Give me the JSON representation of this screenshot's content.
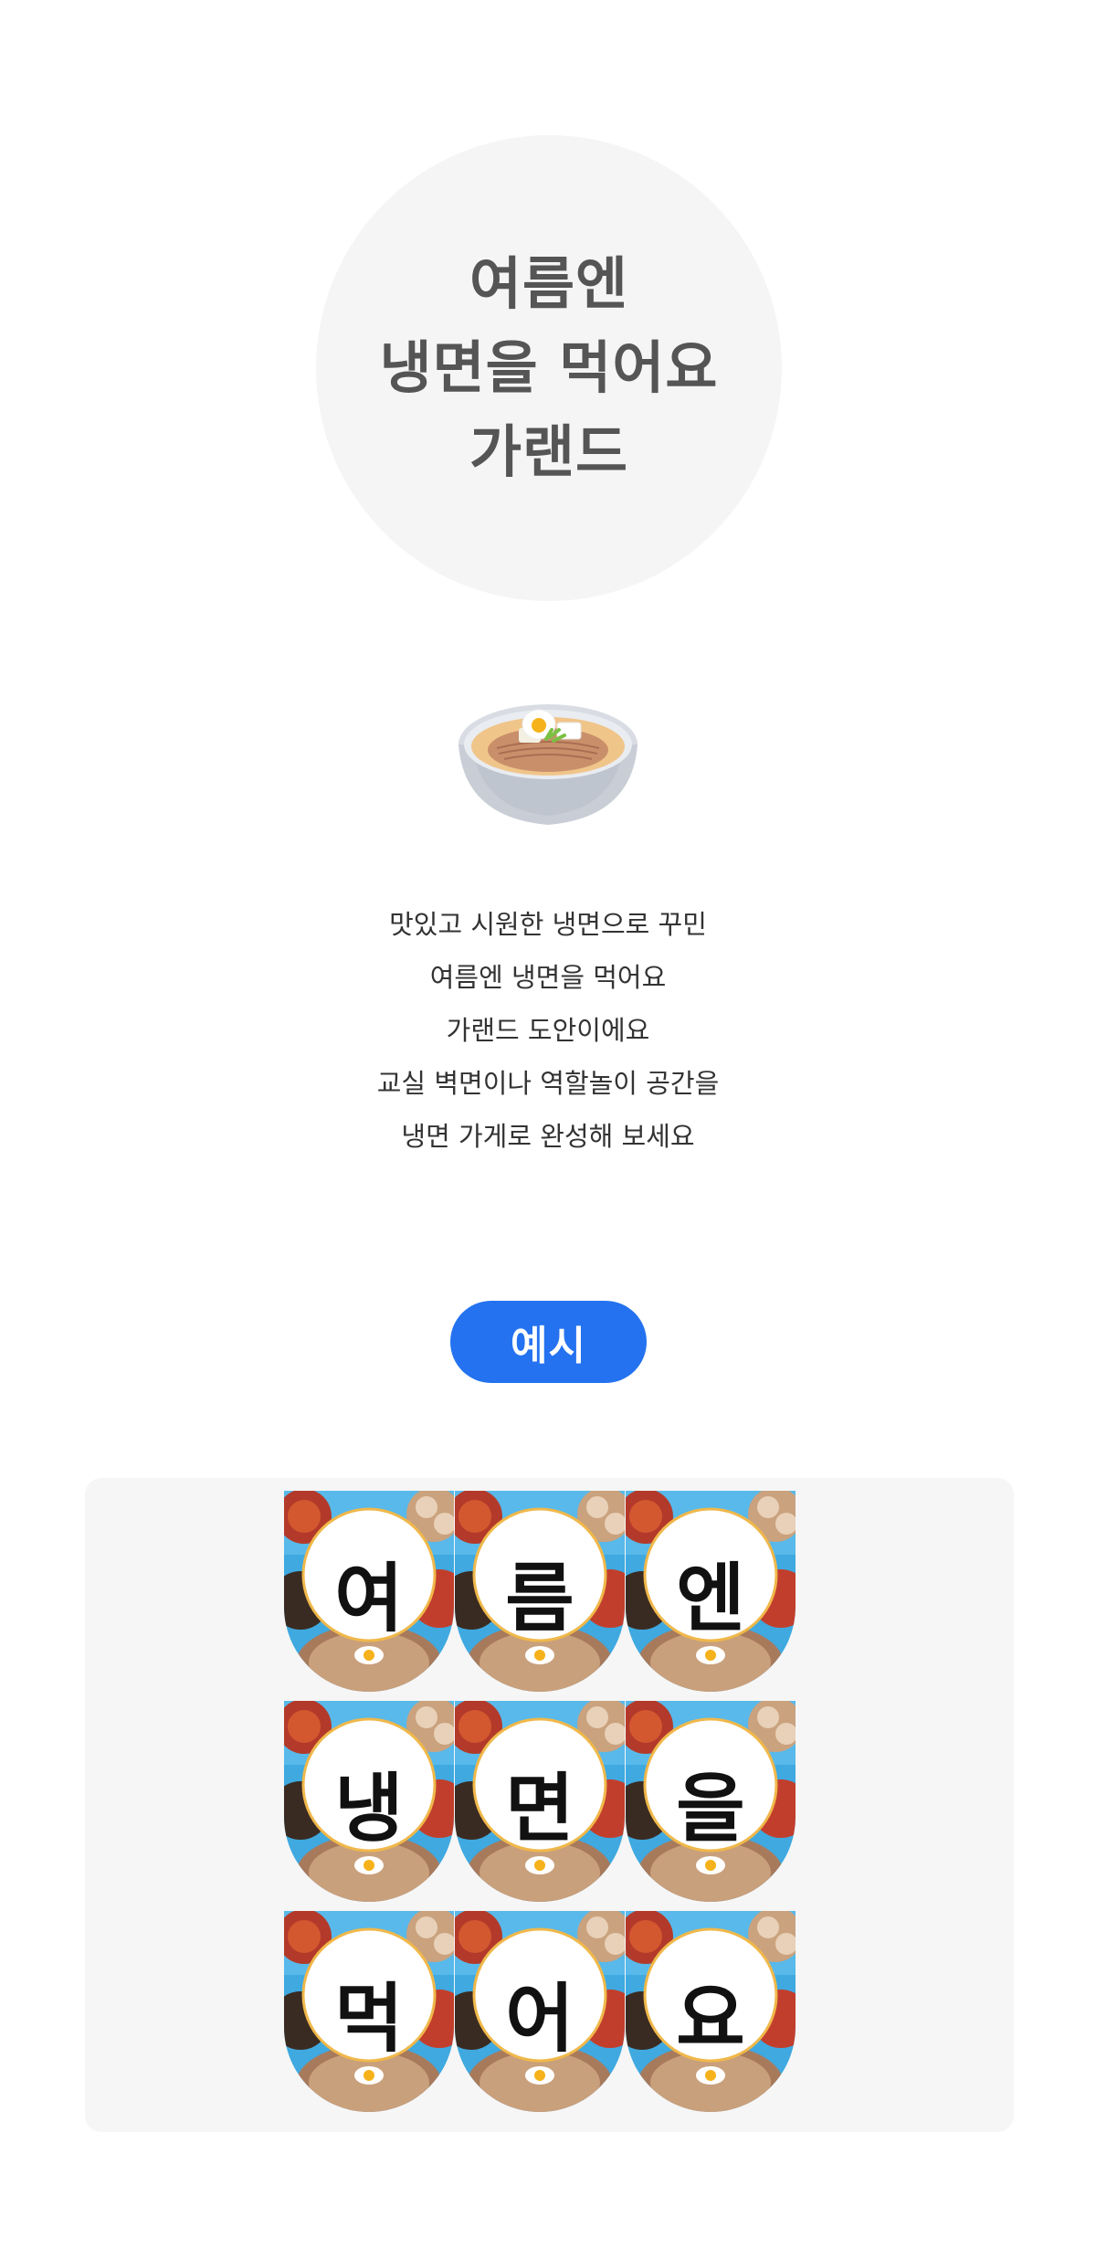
{
  "title": {
    "line1": "여름엔",
    "line2": "냉면을 먹어요",
    "line3": "가랜드"
  },
  "illustration": "naengmyeon-bowl",
  "description": [
    "맛있고 시원한 냉면으로 꾸민",
    "여름엔 냉면을 먹어요",
    "가랜드 도안이에요",
    "교실 벽면이나 역할놀이 공간을",
    "냉면 가게로 완성해 보세요"
  ],
  "example_button": "예시",
  "garland": {
    "letters": [
      "여",
      "름",
      "엔",
      "냉",
      "면",
      "을",
      "먹",
      "어",
      "요"
    ]
  },
  "colors": {
    "title_bg": "#f5f5f5",
    "title_text": "#555555",
    "button": "#2472f0",
    "panel_bg": "#f6f6f6",
    "card_ring": "#f0b84a"
  }
}
